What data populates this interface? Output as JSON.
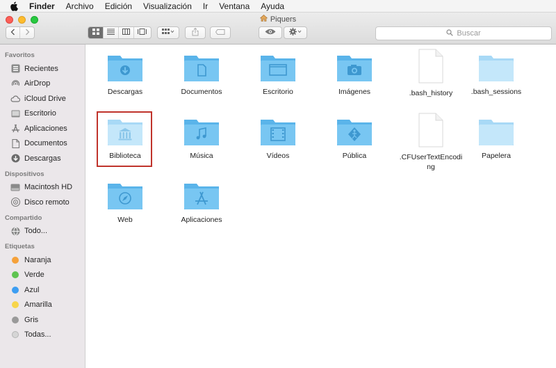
{
  "menubar": {
    "apple_icon": "apple-logo-icon",
    "items": [
      "Finder",
      "Archivo",
      "Edición",
      "Visualización",
      "Ir",
      "Ventana",
      "Ayuda"
    ]
  },
  "window": {
    "title": "Piquers",
    "title_icon": "home-icon"
  },
  "toolbar": {
    "search_placeholder": "Buscar"
  },
  "sidebar": {
    "sections": [
      {
        "header": "Favoritos",
        "items": [
          {
            "label": "Recientes",
            "icon": "recents-icon"
          },
          {
            "label": "AirDrop",
            "icon": "airdrop-icon"
          },
          {
            "label": "iCloud Drive",
            "icon": "cloud-icon"
          },
          {
            "label": "Escritorio",
            "icon": "desktop-icon"
          },
          {
            "label": "Aplicaciones",
            "icon": "applications-icon"
          },
          {
            "label": "Documentos",
            "icon": "document-icon"
          },
          {
            "label": "Descargas",
            "icon": "download-icon"
          }
        ]
      },
      {
        "header": "Dispositivos",
        "items": [
          {
            "label": "Macintosh HD",
            "icon": "hard-drive-icon"
          },
          {
            "label": "Disco remoto",
            "icon": "remote-disc-icon"
          }
        ]
      },
      {
        "header": "Compartido",
        "items": [
          {
            "label": "Todo...",
            "icon": "network-icon"
          }
        ]
      },
      {
        "header": "Etiquetas",
        "items": [
          {
            "label": "Naranja",
            "color": "#f5a13a"
          },
          {
            "label": "Verde",
            "color": "#5fc451"
          },
          {
            "label": "Azul",
            "color": "#3d9ef2"
          },
          {
            "label": "Amarilla",
            "color": "#f7d54a"
          },
          {
            "label": "Gris",
            "color": "#9a9a9a"
          },
          {
            "label": "Todas...",
            "color": "#d6d6d6"
          }
        ]
      }
    ]
  },
  "files": [
    {
      "label": "Descargas",
      "type": "folder",
      "glyph": "download-glyph"
    },
    {
      "label": "Documentos",
      "type": "folder",
      "glyph": "document-glyph"
    },
    {
      "label": "Escritorio",
      "type": "folder",
      "glyph": "desktop-glyph"
    },
    {
      "label": "Imágenes",
      "type": "folder",
      "glyph": "camera-glyph"
    },
    {
      "label": ".bash_history",
      "type": "file"
    },
    {
      "label": ".bash_sessions",
      "type": "folder-faded"
    },
    {
      "label": "Biblioteca",
      "type": "folder-faded",
      "glyph": "library-glyph",
      "selected_highlight": true
    },
    {
      "label": "Música",
      "type": "folder",
      "glyph": "music-glyph"
    },
    {
      "label": "Vídeos",
      "type": "folder",
      "glyph": "film-glyph"
    },
    {
      "label": "Pública",
      "type": "folder",
      "glyph": "public-glyph"
    },
    {
      "label": ".CFUserTextEncoding",
      "type": "file"
    },
    {
      "label": "Papelera",
      "type": "folder-faded"
    },
    {
      "label": "Web",
      "type": "folder",
      "glyph": "compass-glyph"
    },
    {
      "label": "Aplicaciones",
      "type": "folder",
      "glyph": "apps-glyph"
    }
  ],
  "colors": {
    "folder": "#5ab4ea",
    "folder_faded": "#bfe3f8",
    "highlight": "#c0332b"
  }
}
